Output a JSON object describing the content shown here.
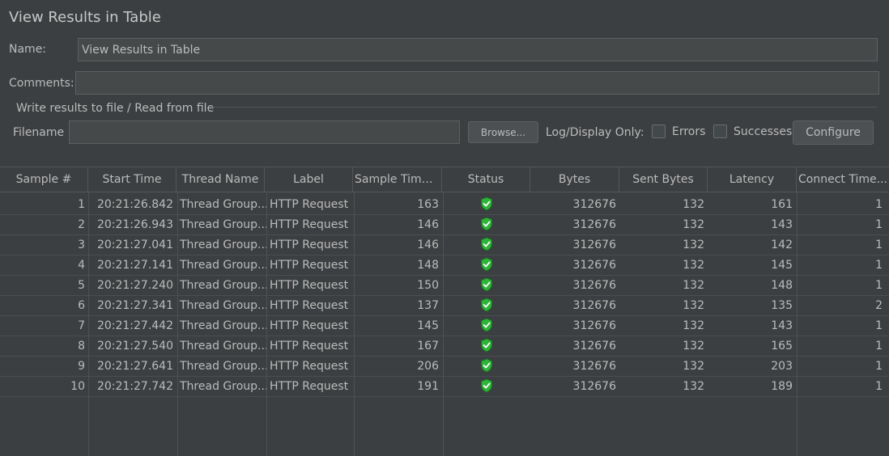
{
  "panel": {
    "title": "View Results in Table",
    "name_label": "Name:",
    "name_value": "View Results in Table",
    "comments_label": "Comments:",
    "comments_value": ""
  },
  "file_section": {
    "legend": "Write results to file / Read from file",
    "filename_label": "Filename",
    "filename_value": "",
    "browse_label": "Browse...",
    "log_display_label": "Log/Display Only:",
    "errors_label": "Errors",
    "successes_label": "Successes",
    "configure_label": "Configure"
  },
  "table": {
    "columns": [
      "Sample #",
      "Start Time",
      "Thread Name",
      "Label",
      "Sample Time(...",
      "Status",
      "Bytes",
      "Sent Bytes",
      "Latency",
      "Connect Time..."
    ],
    "rows": [
      {
        "sample": "1",
        "start": "20:21:26.842",
        "thread": "Thread Group...",
        "label": "HTTP Request",
        "time": "163",
        "status": "success",
        "bytes": "312676",
        "sent": "132",
        "latency": "161",
        "connect": "1"
      },
      {
        "sample": "2",
        "start": "20:21:26.943",
        "thread": "Thread Group...",
        "label": "HTTP Request",
        "time": "146",
        "status": "success",
        "bytes": "312676",
        "sent": "132",
        "latency": "143",
        "connect": "1"
      },
      {
        "sample": "3",
        "start": "20:21:27.041",
        "thread": "Thread Group...",
        "label": "HTTP Request",
        "time": "146",
        "status": "success",
        "bytes": "312676",
        "sent": "132",
        "latency": "142",
        "connect": "1"
      },
      {
        "sample": "4",
        "start": "20:21:27.141",
        "thread": "Thread Group...",
        "label": "HTTP Request",
        "time": "148",
        "status": "success",
        "bytes": "312676",
        "sent": "132",
        "latency": "145",
        "connect": "1"
      },
      {
        "sample": "5",
        "start": "20:21:27.240",
        "thread": "Thread Group...",
        "label": "HTTP Request",
        "time": "150",
        "status": "success",
        "bytes": "312676",
        "sent": "132",
        "latency": "148",
        "connect": "1"
      },
      {
        "sample": "6",
        "start": "20:21:27.341",
        "thread": "Thread Group...",
        "label": "HTTP Request",
        "time": "137",
        "status": "success",
        "bytes": "312676",
        "sent": "132",
        "latency": "135",
        "connect": "2"
      },
      {
        "sample": "7",
        "start": "20:21:27.442",
        "thread": "Thread Group...",
        "label": "HTTP Request",
        "time": "145",
        "status": "success",
        "bytes": "312676",
        "sent": "132",
        "latency": "143",
        "connect": "1"
      },
      {
        "sample": "8",
        "start": "20:21:27.540",
        "thread": "Thread Group...",
        "label": "HTTP Request",
        "time": "167",
        "status": "success",
        "bytes": "312676",
        "sent": "132",
        "latency": "165",
        "connect": "1"
      },
      {
        "sample": "9",
        "start": "20:21:27.641",
        "thread": "Thread Group...",
        "label": "HTTP Request",
        "time": "206",
        "status": "success",
        "bytes": "312676",
        "sent": "132",
        "latency": "203",
        "connect": "1"
      },
      {
        "sample": "10",
        "start": "20:21:27.742",
        "thread": "Thread Group...",
        "label": "HTTP Request",
        "time": "191",
        "status": "success",
        "bytes": "312676",
        "sent": "132",
        "latency": "189",
        "connect": "1"
      }
    ]
  },
  "colors": {
    "background": "#3c3f41",
    "text": "#bbbbbb",
    "success_shield": "#2fb43a"
  },
  "icons": {
    "status_success": "shield-check-icon"
  }
}
